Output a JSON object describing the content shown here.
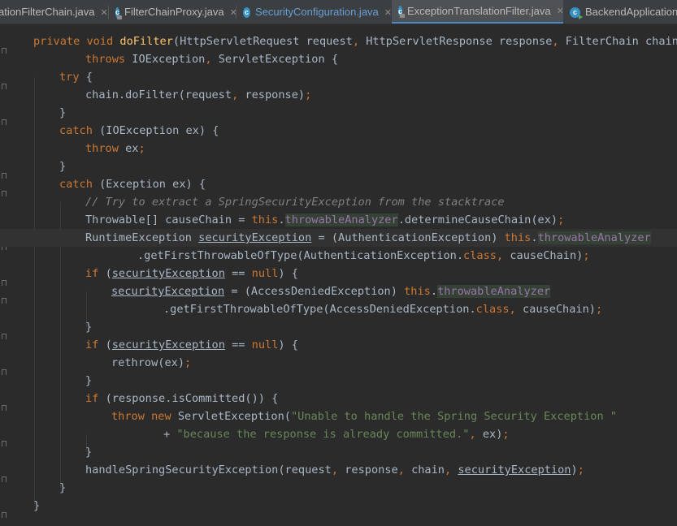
{
  "tabs": [
    {
      "label": "ationFilterChain.java",
      "icon": "java-class-icon",
      "closable": true,
      "active": false
    },
    {
      "label": "FilterChainProxy.java",
      "icon": "java-class-locked-icon",
      "closable": true,
      "active": false
    },
    {
      "label": "SecurityConfiguration.java",
      "icon": "java-class-icon",
      "closable": true,
      "active": false
    },
    {
      "label": "ExceptionTranslationFilter.java",
      "icon": "java-class-locked-icon",
      "closable": true,
      "active": true
    },
    {
      "label": "BackendApplication.j",
      "icon": "java-class-run-icon",
      "closable": false,
      "active": false
    }
  ],
  "code_lines": [
    {
      "indent": 0,
      "tokens": [
        [
          "kw",
          "private "
        ],
        [
          "kw",
          "void "
        ],
        [
          "fn",
          "doFilter"
        ],
        [
          "t",
          "(HttpServletRequest request"
        ],
        [
          "kw",
          ", "
        ],
        [
          "t",
          "HttpServletResponse response"
        ],
        [
          "kw",
          ", "
        ],
        [
          "t",
          "FilterChain chain)"
        ]
      ]
    },
    {
      "indent": 2,
      "tokens": [
        [
          "kw",
          "throws "
        ],
        [
          "t",
          "IOException"
        ],
        [
          "kw",
          ", "
        ],
        [
          "t",
          "ServletException {"
        ]
      ]
    },
    {
      "indent": 1,
      "tokens": [
        [
          "kw",
          "try "
        ],
        [
          "t",
          "{"
        ]
      ]
    },
    {
      "indent": 2,
      "tokens": [
        [
          "t",
          "chain.doFilter(request"
        ],
        [
          "kw",
          ", "
        ],
        [
          "t",
          "response)"
        ],
        [
          "kw",
          ";"
        ]
      ]
    },
    {
      "indent": 1,
      "tokens": [
        [
          "t",
          "}"
        ]
      ]
    },
    {
      "indent": 1,
      "tokens": [
        [
          "kw",
          "catch "
        ],
        [
          "t",
          "(IOException ex) {"
        ]
      ]
    },
    {
      "indent": 2,
      "tokens": [
        [
          "kw",
          "throw "
        ],
        [
          "t",
          "ex"
        ],
        [
          "kw",
          ";"
        ]
      ]
    },
    {
      "indent": 1,
      "tokens": [
        [
          "t",
          "}"
        ]
      ]
    },
    {
      "indent": 1,
      "tokens": [
        [
          "kw",
          "catch "
        ],
        [
          "t",
          "(Exception ex) {"
        ]
      ]
    },
    {
      "indent": 2,
      "tokens": [
        [
          "cmt",
          "// Try to extract a SpringSecurityException from the stacktrace"
        ]
      ]
    },
    {
      "indent": 2,
      "tokens": [
        [
          "t",
          "Throwable[] causeChain = "
        ],
        [
          "kw",
          "this"
        ],
        [
          "t",
          "."
        ],
        [
          "fld",
          "throwableAnalyzer"
        ],
        [
          "t",
          ".determineCauseChain(ex)"
        ],
        [
          "kw",
          ";"
        ]
      ]
    },
    {
      "indent": 2,
      "caret": true,
      "tokens": [
        [
          "t",
          "RuntimeException "
        ],
        [
          "ul",
          "securityException"
        ],
        [
          "t",
          " = (AuthenticationException) "
        ],
        [
          "kw",
          "this"
        ],
        [
          "t",
          "."
        ],
        [
          "fld",
          "throwableAnalyzer"
        ]
      ]
    },
    {
      "indent": 4,
      "tokens": [
        [
          "t",
          ".getFirstThrowableOfType(AuthenticationException."
        ],
        [
          "kw",
          "class"
        ],
        [
          "kw",
          ", "
        ],
        [
          "t",
          "causeChain)"
        ],
        [
          "kw",
          ";"
        ]
      ]
    },
    {
      "indent": 2,
      "tokens": [
        [
          "kw",
          "if "
        ],
        [
          "t",
          "("
        ],
        [
          "ul",
          "securityException"
        ],
        [
          "t",
          " == "
        ],
        [
          "kw",
          "null"
        ],
        [
          "t",
          ") {"
        ]
      ]
    },
    {
      "indent": 3,
      "tokens": [
        [
          "ul",
          "securityException"
        ],
        [
          "t",
          " = (AccessDeniedException) "
        ],
        [
          "kw",
          "this"
        ],
        [
          "t",
          "."
        ],
        [
          "fld",
          "throwableAnalyzer"
        ]
      ]
    },
    {
      "indent": 5,
      "tokens": [
        [
          "t",
          ".getFirstThrowableOfType(AccessDeniedException."
        ],
        [
          "kw",
          "class"
        ],
        [
          "kw",
          ", "
        ],
        [
          "t",
          "causeChain)"
        ],
        [
          "kw",
          ";"
        ]
      ]
    },
    {
      "indent": 2,
      "tokens": [
        [
          "t",
          "}"
        ]
      ]
    },
    {
      "indent": 2,
      "tokens": [
        [
          "kw",
          "if "
        ],
        [
          "t",
          "("
        ],
        [
          "ul",
          "securityException"
        ],
        [
          "t",
          " == "
        ],
        [
          "kw",
          "null"
        ],
        [
          "t",
          ") {"
        ]
      ]
    },
    {
      "indent": 3,
      "tokens": [
        [
          "t",
          "rethrow(ex)"
        ],
        [
          "kw",
          ";"
        ]
      ]
    },
    {
      "indent": 2,
      "tokens": [
        [
          "t",
          "}"
        ]
      ]
    },
    {
      "indent": 2,
      "tokens": [
        [
          "kw",
          "if "
        ],
        [
          "t",
          "(response.isCommitted()) {"
        ]
      ]
    },
    {
      "indent": 3,
      "tokens": [
        [
          "kw",
          "throw new "
        ],
        [
          "t",
          "ServletException("
        ],
        [
          "str",
          "\"Unable to handle the Spring Security Exception \""
        ]
      ]
    },
    {
      "indent": 5,
      "tokens": [
        [
          "t",
          "+ "
        ],
        [
          "str",
          "\"because the response is already committed.\""
        ],
        [
          "kw",
          ", "
        ],
        [
          "t",
          "ex)"
        ],
        [
          "kw",
          ";"
        ]
      ]
    },
    {
      "indent": 2,
      "tokens": [
        [
          "t",
          "}"
        ]
      ]
    },
    {
      "indent": 2,
      "tokens": [
        [
          "t",
          "handleSpringSecurityException(request"
        ],
        [
          "kw",
          ", "
        ],
        [
          "t",
          "response"
        ],
        [
          "kw",
          ", "
        ],
        [
          "t",
          "chain"
        ],
        [
          "kw",
          ", "
        ],
        [
          "ul",
          "securityException"
        ],
        [
          "t",
          ")"
        ],
        [
          "kw",
          ";"
        ]
      ]
    },
    {
      "indent": 1,
      "tokens": [
        [
          "t",
          "}"
        ]
      ]
    },
    {
      "indent": 0,
      "tokens": [
        [
          "t",
          "}"
        ]
      ]
    }
  ]
}
